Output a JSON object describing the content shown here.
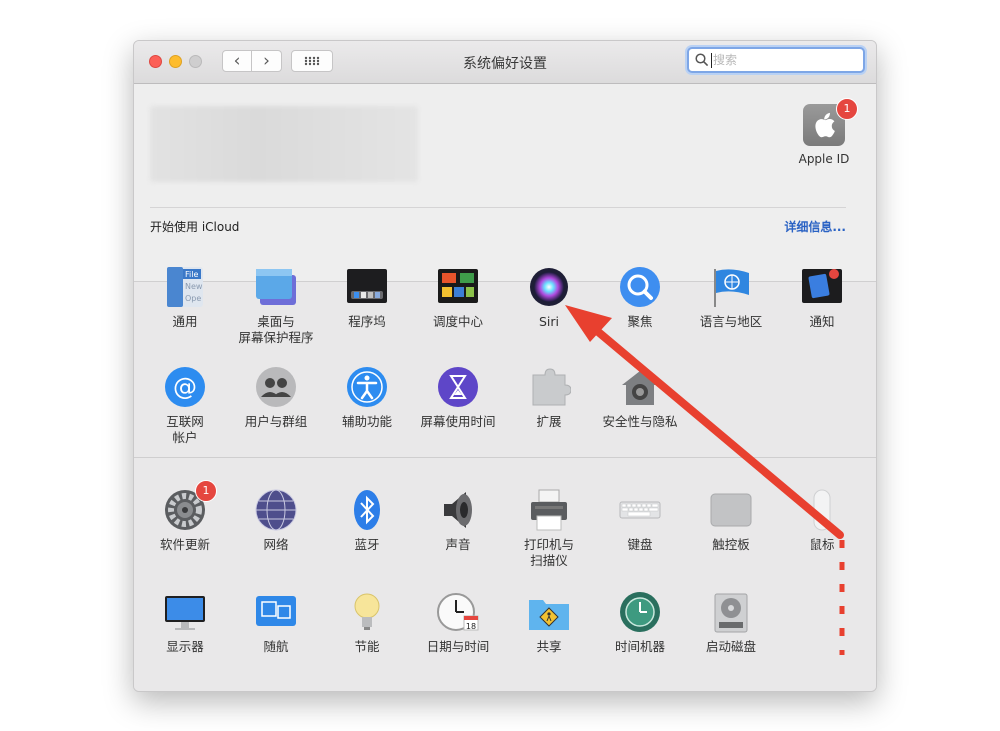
{
  "window": {
    "title": "系统偏好设置"
  },
  "toolbar": {
    "back": "‹",
    "forward": "›",
    "grid": "⠿⠿"
  },
  "search": {
    "placeholder": "搜索"
  },
  "account": {
    "apple_id_label": "Apple ID",
    "apple_id_badge": "1",
    "icloud_prompt": "开始使用 iCloud",
    "details_link": "详细信息..."
  },
  "prefs_row1": [
    {
      "name": "general",
      "label": "通用"
    },
    {
      "name": "desktop-screensaver",
      "label": "桌面与\n屏幕保护程序"
    },
    {
      "name": "dock",
      "label": "程序坞"
    },
    {
      "name": "mission-control",
      "label": "调度中心"
    },
    {
      "name": "siri",
      "label": "Siri"
    },
    {
      "name": "spotlight",
      "label": "聚焦"
    },
    {
      "name": "language-region",
      "label": "语言与地区"
    },
    {
      "name": "notifications",
      "label": "通知"
    }
  ],
  "prefs_row2": [
    {
      "name": "internet-accounts",
      "label": "互联网\n帐户"
    },
    {
      "name": "users-groups",
      "label": "用户与群组"
    },
    {
      "name": "accessibility",
      "label": "辅助功能"
    },
    {
      "name": "screen-time",
      "label": "屏幕使用时间"
    },
    {
      "name": "extensions",
      "label": "扩展"
    },
    {
      "name": "security-privacy",
      "label": "安全性与隐私"
    }
  ],
  "prefs_row3": [
    {
      "name": "software-update",
      "label": "软件更新",
      "badge": "1"
    },
    {
      "name": "network",
      "label": "网络"
    },
    {
      "name": "bluetooth",
      "label": "蓝牙"
    },
    {
      "name": "sound",
      "label": "声音"
    },
    {
      "name": "printers-scanners",
      "label": "打印机与\n扫描仪"
    },
    {
      "name": "keyboard",
      "label": "键盘"
    },
    {
      "name": "trackpad",
      "label": "触控板"
    },
    {
      "name": "mouse",
      "label": "鼠标"
    }
  ],
  "prefs_row4": [
    {
      "name": "displays",
      "label": "显示器"
    },
    {
      "name": "sidecar",
      "label": "随航"
    },
    {
      "name": "energy-saver",
      "label": "节能"
    },
    {
      "name": "date-time",
      "label": "日期与时间"
    },
    {
      "name": "sharing",
      "label": "共享"
    },
    {
      "name": "time-machine",
      "label": "时间机器"
    },
    {
      "name": "startup-disk",
      "label": "启动磁盘"
    }
  ],
  "colors": {
    "accent": "#2a62c4",
    "badge": "#e5463f",
    "annotation_arrow": "#e8402f"
  }
}
